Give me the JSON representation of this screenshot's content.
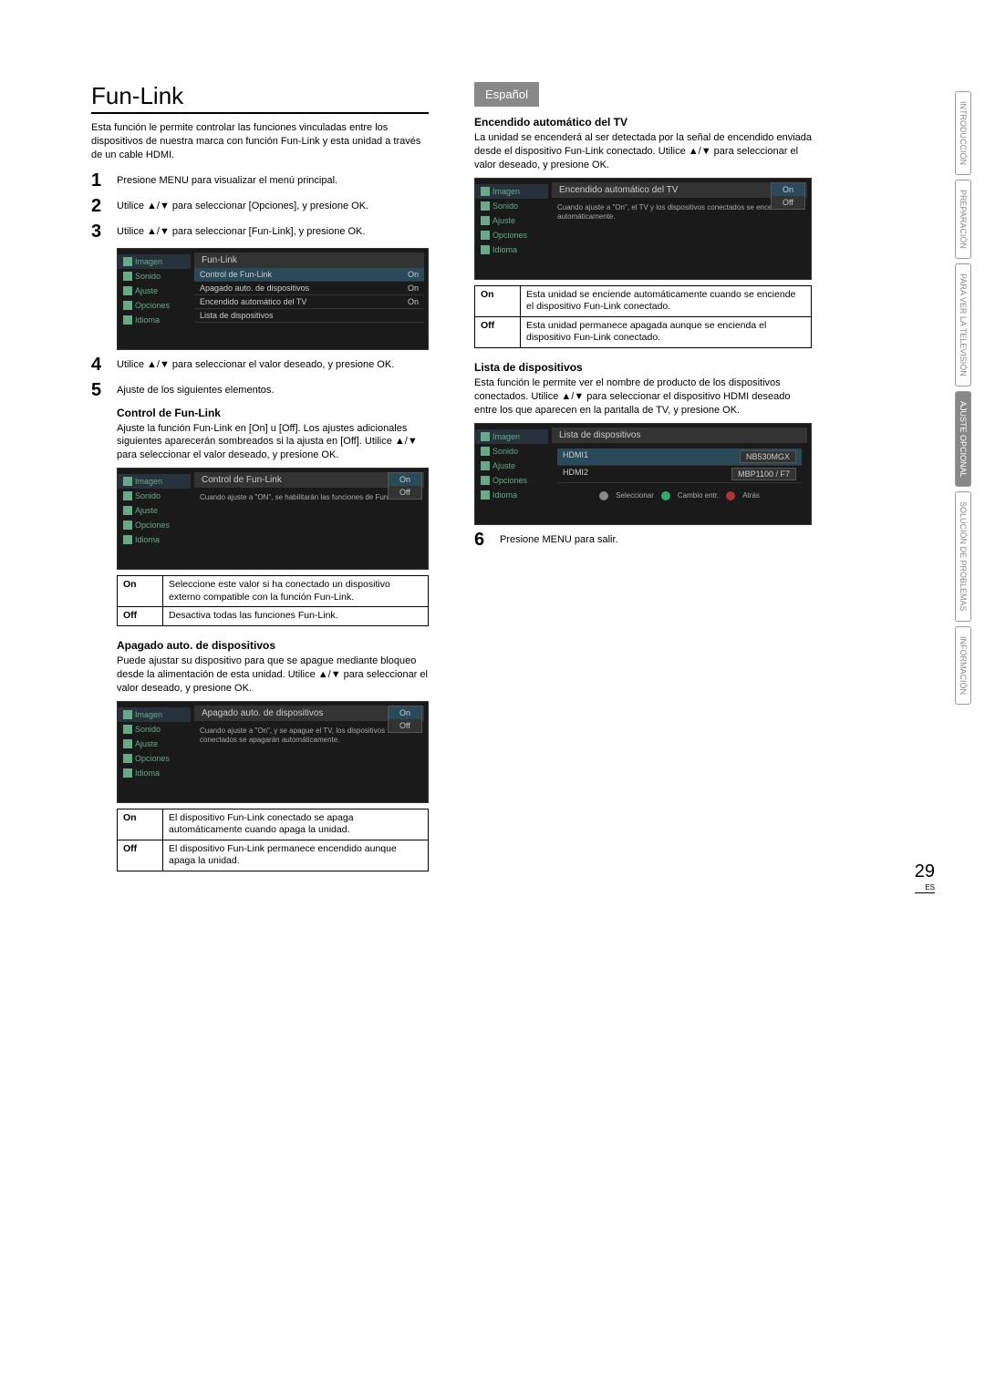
{
  "lang_tab": "Español",
  "page_number": "29",
  "page_lang": "ES",
  "side_tabs": [
    "INTRODUCCIÓN",
    "PREPARACIÓN",
    "PARA VER LA TELEVISIÓN",
    "AJUSTE OPCIONAL",
    "SOLUCIÓN DE PROBLEMAS",
    "INFORMACIÓN"
  ],
  "left": {
    "title": "Fun-Link",
    "intro": "Esta función le permite controlar las funciones vinculadas entre los dispositivos de nuestra marca con función Fun-Link y esta unidad a través de un cable HDMI.",
    "steps": {
      "s1": "Presione MENU para visualizar el menú principal.",
      "s2": "Utilice ▲/▼ para seleccionar [Opciones], y presione OK.",
      "s3": "Utilice ▲/▼ para seleccionar [Fun-Link], y presione OK.",
      "s4": "Utilice ▲/▼ para seleccionar el valor deseado, y presione OK.",
      "s5": "Ajuste de los siguientes elementos."
    },
    "ss1": {
      "title": "Fun-Link",
      "menu": [
        "Imagen",
        "Sonido",
        "Ajuste",
        "Opciones",
        "Idioma"
      ],
      "rows": [
        {
          "k": "Control de Fun-Link",
          "v": "On"
        },
        {
          "k": "Apagado auto. de dispositivos",
          "v": "On"
        },
        {
          "k": "Encendido automático del TV",
          "v": "On"
        },
        {
          "k": "Lista de dispositivos",
          "v": ""
        }
      ]
    },
    "control": {
      "heading": "Control de Fun-Link",
      "desc": "Ajuste la función Fun-Link en [On] u [Off]. Los ajustes adicionales siguientes aparecerán sombreados si la ajusta en [Off]. Utilice ▲/▼ para seleccionar el valor deseado, y presione OK.",
      "ss_title": "Control de Fun-Link",
      "ss_help": "Cuando ajuste a \"ON\", se habilitarán las funciones de Fun-Link.",
      "opts": [
        "On",
        "Off"
      ],
      "table": {
        "on_label": "On",
        "on_text": "Seleccione este valor si ha conectado un dispositivo externo compatible con la función Fun-Link.",
        "off_label": "Off",
        "off_text": "Desactiva todas las funciones Fun-Link."
      }
    },
    "apagado": {
      "heading": "Apagado auto. de dispositivos",
      "desc": "Puede ajustar su dispositivo para que se apague mediante bloqueo desde la alimentación de esta unidad. Utilice ▲/▼ para seleccionar el valor deseado, y presione OK.",
      "ss_title": "Apagado auto. de dispositivos",
      "ss_help": "Cuando ajuste a \"On\", y se apague el TV, los dispositivos conectados se apagarán automáticamente.",
      "opts": [
        "On",
        "Off"
      ],
      "table": {
        "on_label": "On",
        "on_text": "El dispositivo Fun-Link conectado se apaga automáticamente cuando apaga la unidad.",
        "off_label": "Off",
        "off_text": "El dispositivo Fun-Link permanece encendido aunque apaga la unidad."
      }
    }
  },
  "right": {
    "encendido": {
      "heading": "Encendido automático del TV",
      "desc": "La unidad se encenderá al ser detectada por la señal de encendido enviada desde el dispositivo Fun-Link conectado. Utilice ▲/▼ para seleccionar el valor deseado, y presione OK.",
      "ss_title": "Encendido automático del TV",
      "ss_help": "Cuando ajuste a \"On\", el TV y los dispositivos conectados se encenderán automáticamente.",
      "opts": [
        "On",
        "Off"
      ],
      "table": {
        "on_label": "On",
        "on_text": "Esta unidad se enciende automáticamente cuando se enciende el dispositivo Fun-Link conectado.",
        "off_label": "Off",
        "off_text": "Esta unidad permanece apagada aunque se encienda el dispositivo Fun-Link conectado."
      }
    },
    "lista": {
      "heading": "Lista de dispositivos",
      "desc": "Esta función le permite ver el nombre de producto de los dispositivos conectados. Utilice ▲/▼ para seleccionar el dispositivo HDMI deseado entre los que aparecen en la pantalla de TV, y presione OK.",
      "ss_title": "Lista de dispositivos",
      "rows": [
        {
          "k": "HDMI1",
          "v": "NB530MGX"
        },
        {
          "k": "HDMI2",
          "v": "MBP1100 / F7"
        }
      ],
      "foot": {
        "a": "Seleccionar",
        "b": "Cambio entr.",
        "c": "Atrás"
      }
    },
    "step6": "Presione MENU para salir."
  },
  "menu": [
    "Imagen",
    "Sonido",
    "Ajuste",
    "Opciones",
    "Idioma"
  ]
}
